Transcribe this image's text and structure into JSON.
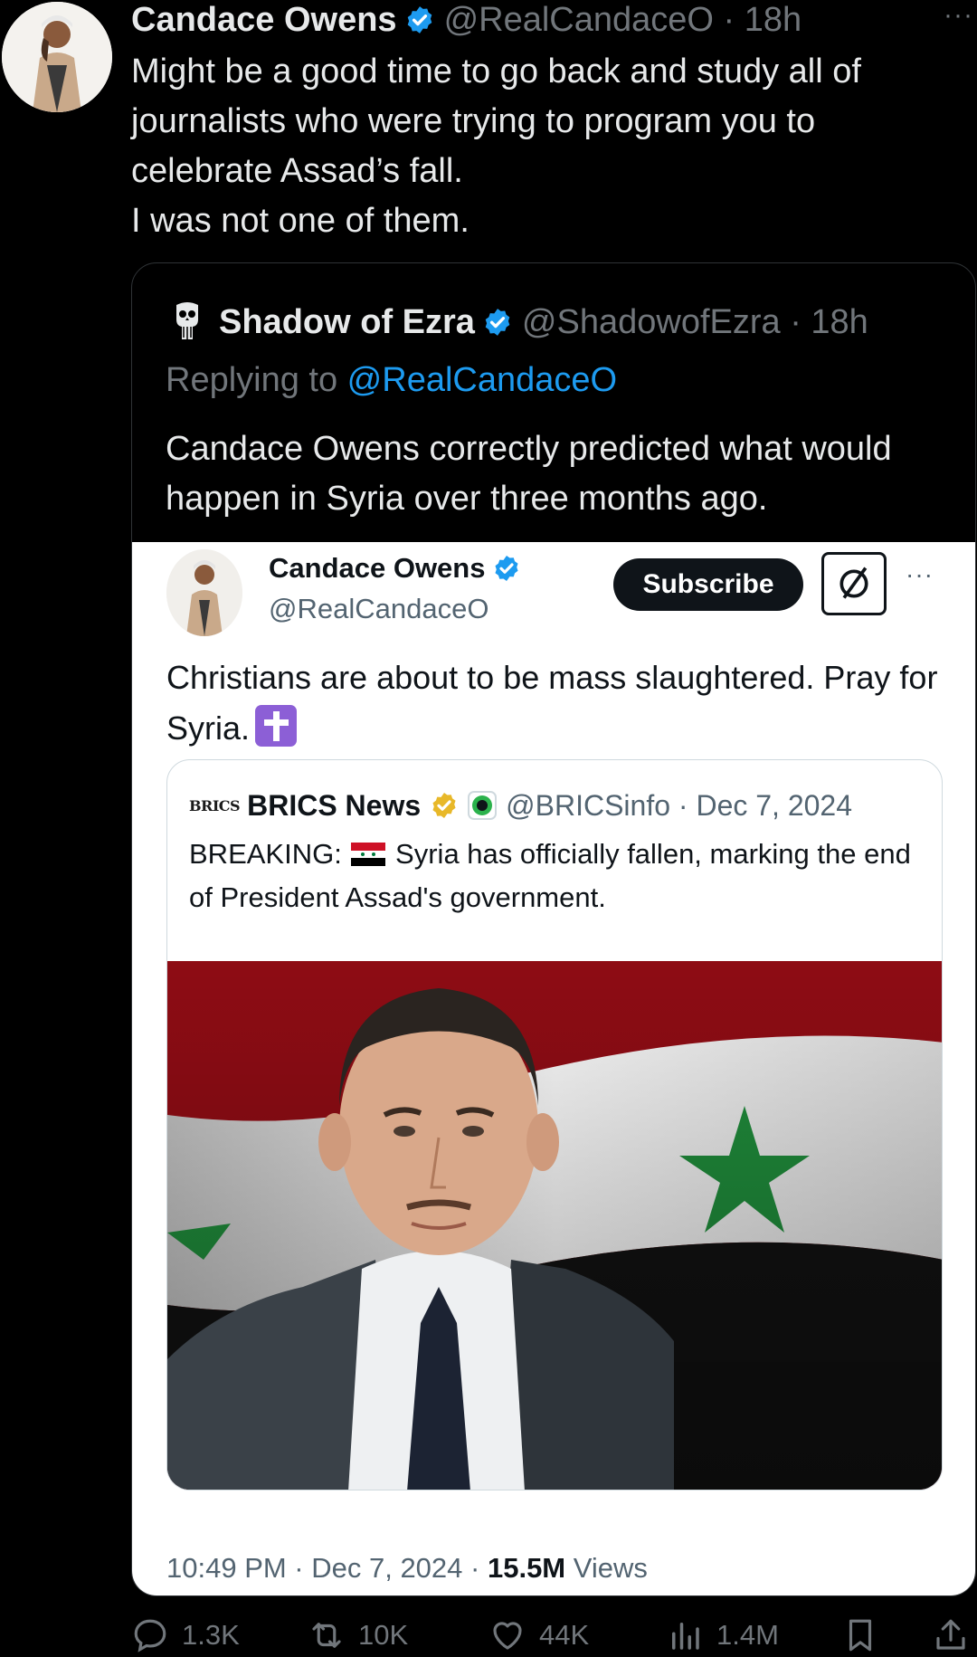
{
  "main_post": {
    "author_name": "Candace Owens",
    "handle_time": "@RealCandaceO · 18h",
    "more": "···",
    "text": "Might be a good time to go back and study all of journalists who were trying to program you to celebrate Assad’s fall.\nI was not one of them."
  },
  "quoted_post": {
    "author_name": "Shadow of Ezra",
    "handle_time": "@ShadowofEzra · 18h",
    "replying_prefix": "Replying to ",
    "replying_handle": "@RealCandaceO",
    "text": "Candace Owens correctly predicted what would happen in Syria over three months ago."
  },
  "screenshot_post": {
    "author_name": "Candace Owens",
    "handle": "@RealCandaceO",
    "subscribe_label": "Subscribe",
    "more": "···",
    "text": "Christians are about to be mass slaughtered. Pray for Syria.",
    "timestamp": "10:49 PM · Dec 7, 2024 · ",
    "views_count": "15.5M",
    "views_label": " Views"
  },
  "brics_post": {
    "logo_text": "BRICS",
    "author_name": "BRICS News",
    "handle_date": "@BRICSinfo · Dec 7, 2024",
    "text_prefix": "BREAKING: ",
    "text_suffix": " Syria has officially fallen, marking the end of President Assad's government."
  },
  "actions": {
    "replies": "1.3K",
    "reposts": "10K",
    "likes": "44K",
    "views": "1.4M"
  },
  "colors": {
    "background": "#000000",
    "text_primary": "#e7e9ea",
    "text_secondary": "#71767b",
    "accent_blue": "#1d9bf0",
    "gold_badge": "#e8b829"
  }
}
